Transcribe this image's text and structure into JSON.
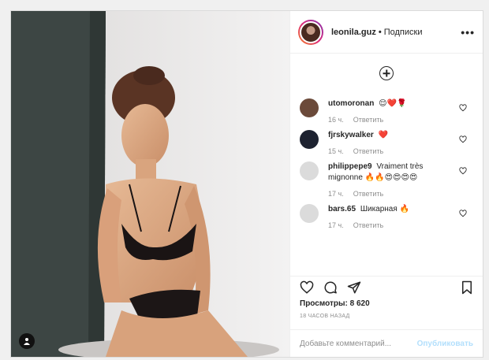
{
  "post": {
    "username": "leonila.guz",
    "separator": "•",
    "follow_label": "Подписки",
    "more_label": "•••"
  },
  "comments": [
    {
      "user": "utomoronan",
      "text": "😌❤️🌹",
      "age": "16 ч.",
      "reply": "Ответить",
      "avatar_color": "#6b4a3a"
    },
    {
      "user": "fjrskywalker",
      "text": "❤️",
      "age": "15 ч.",
      "reply": "Ответить",
      "avatar_color": "#1d2230"
    },
    {
      "user": "philippepe9",
      "text": "Vraiment très mignonne 🔥🔥😍😍😍😍",
      "age": "17 ч.",
      "reply": "Ответить",
      "avatar_color": "#dbdbdb"
    },
    {
      "user": "bars.65",
      "text": "Шикарная 🔥",
      "age": "17 ч.",
      "reply": "Ответить",
      "avatar_color": "#dbdbdb"
    }
  ],
  "stats": {
    "views": "Просмотры: 8 620",
    "time": "18 ЧАСОВ НАЗАД"
  },
  "composer": {
    "placeholder": "Добавьте комментарий...",
    "publish_label": "Опубликовать"
  },
  "icons": {
    "load_more": "plus-circle-icon",
    "like": "heart-icon",
    "comment": "comment-icon",
    "share": "paper-plane-icon",
    "save": "bookmark-icon",
    "tag": "user-tag-icon"
  }
}
